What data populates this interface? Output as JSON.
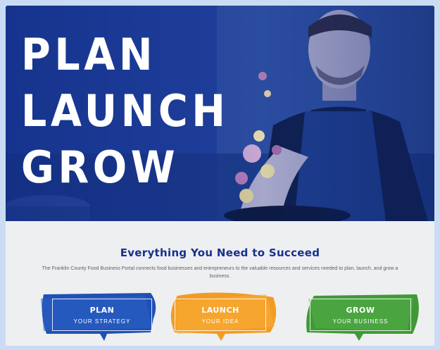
{
  "hero": {
    "lines": [
      "PLAN",
      "LAUNCH",
      "GROW"
    ]
  },
  "intro": {
    "title": "Everything You Need to Succeed",
    "description": "The Franklin County Food Business Portal connects food businesses and entrepreneurs to the valuable resources and services needed to plan, launch, and grow a business."
  },
  "cards": [
    {
      "label": "PLAN",
      "sub": "YOUR STRATEGY",
      "color": "#1e4fb3"
    },
    {
      "label": "LAUNCH",
      "sub": "YOUR IDEA",
      "color": "#f39b22"
    },
    {
      "label": "GROW",
      "sub": "YOUR BUSINESS",
      "color": "#3f9a36"
    }
  ]
}
